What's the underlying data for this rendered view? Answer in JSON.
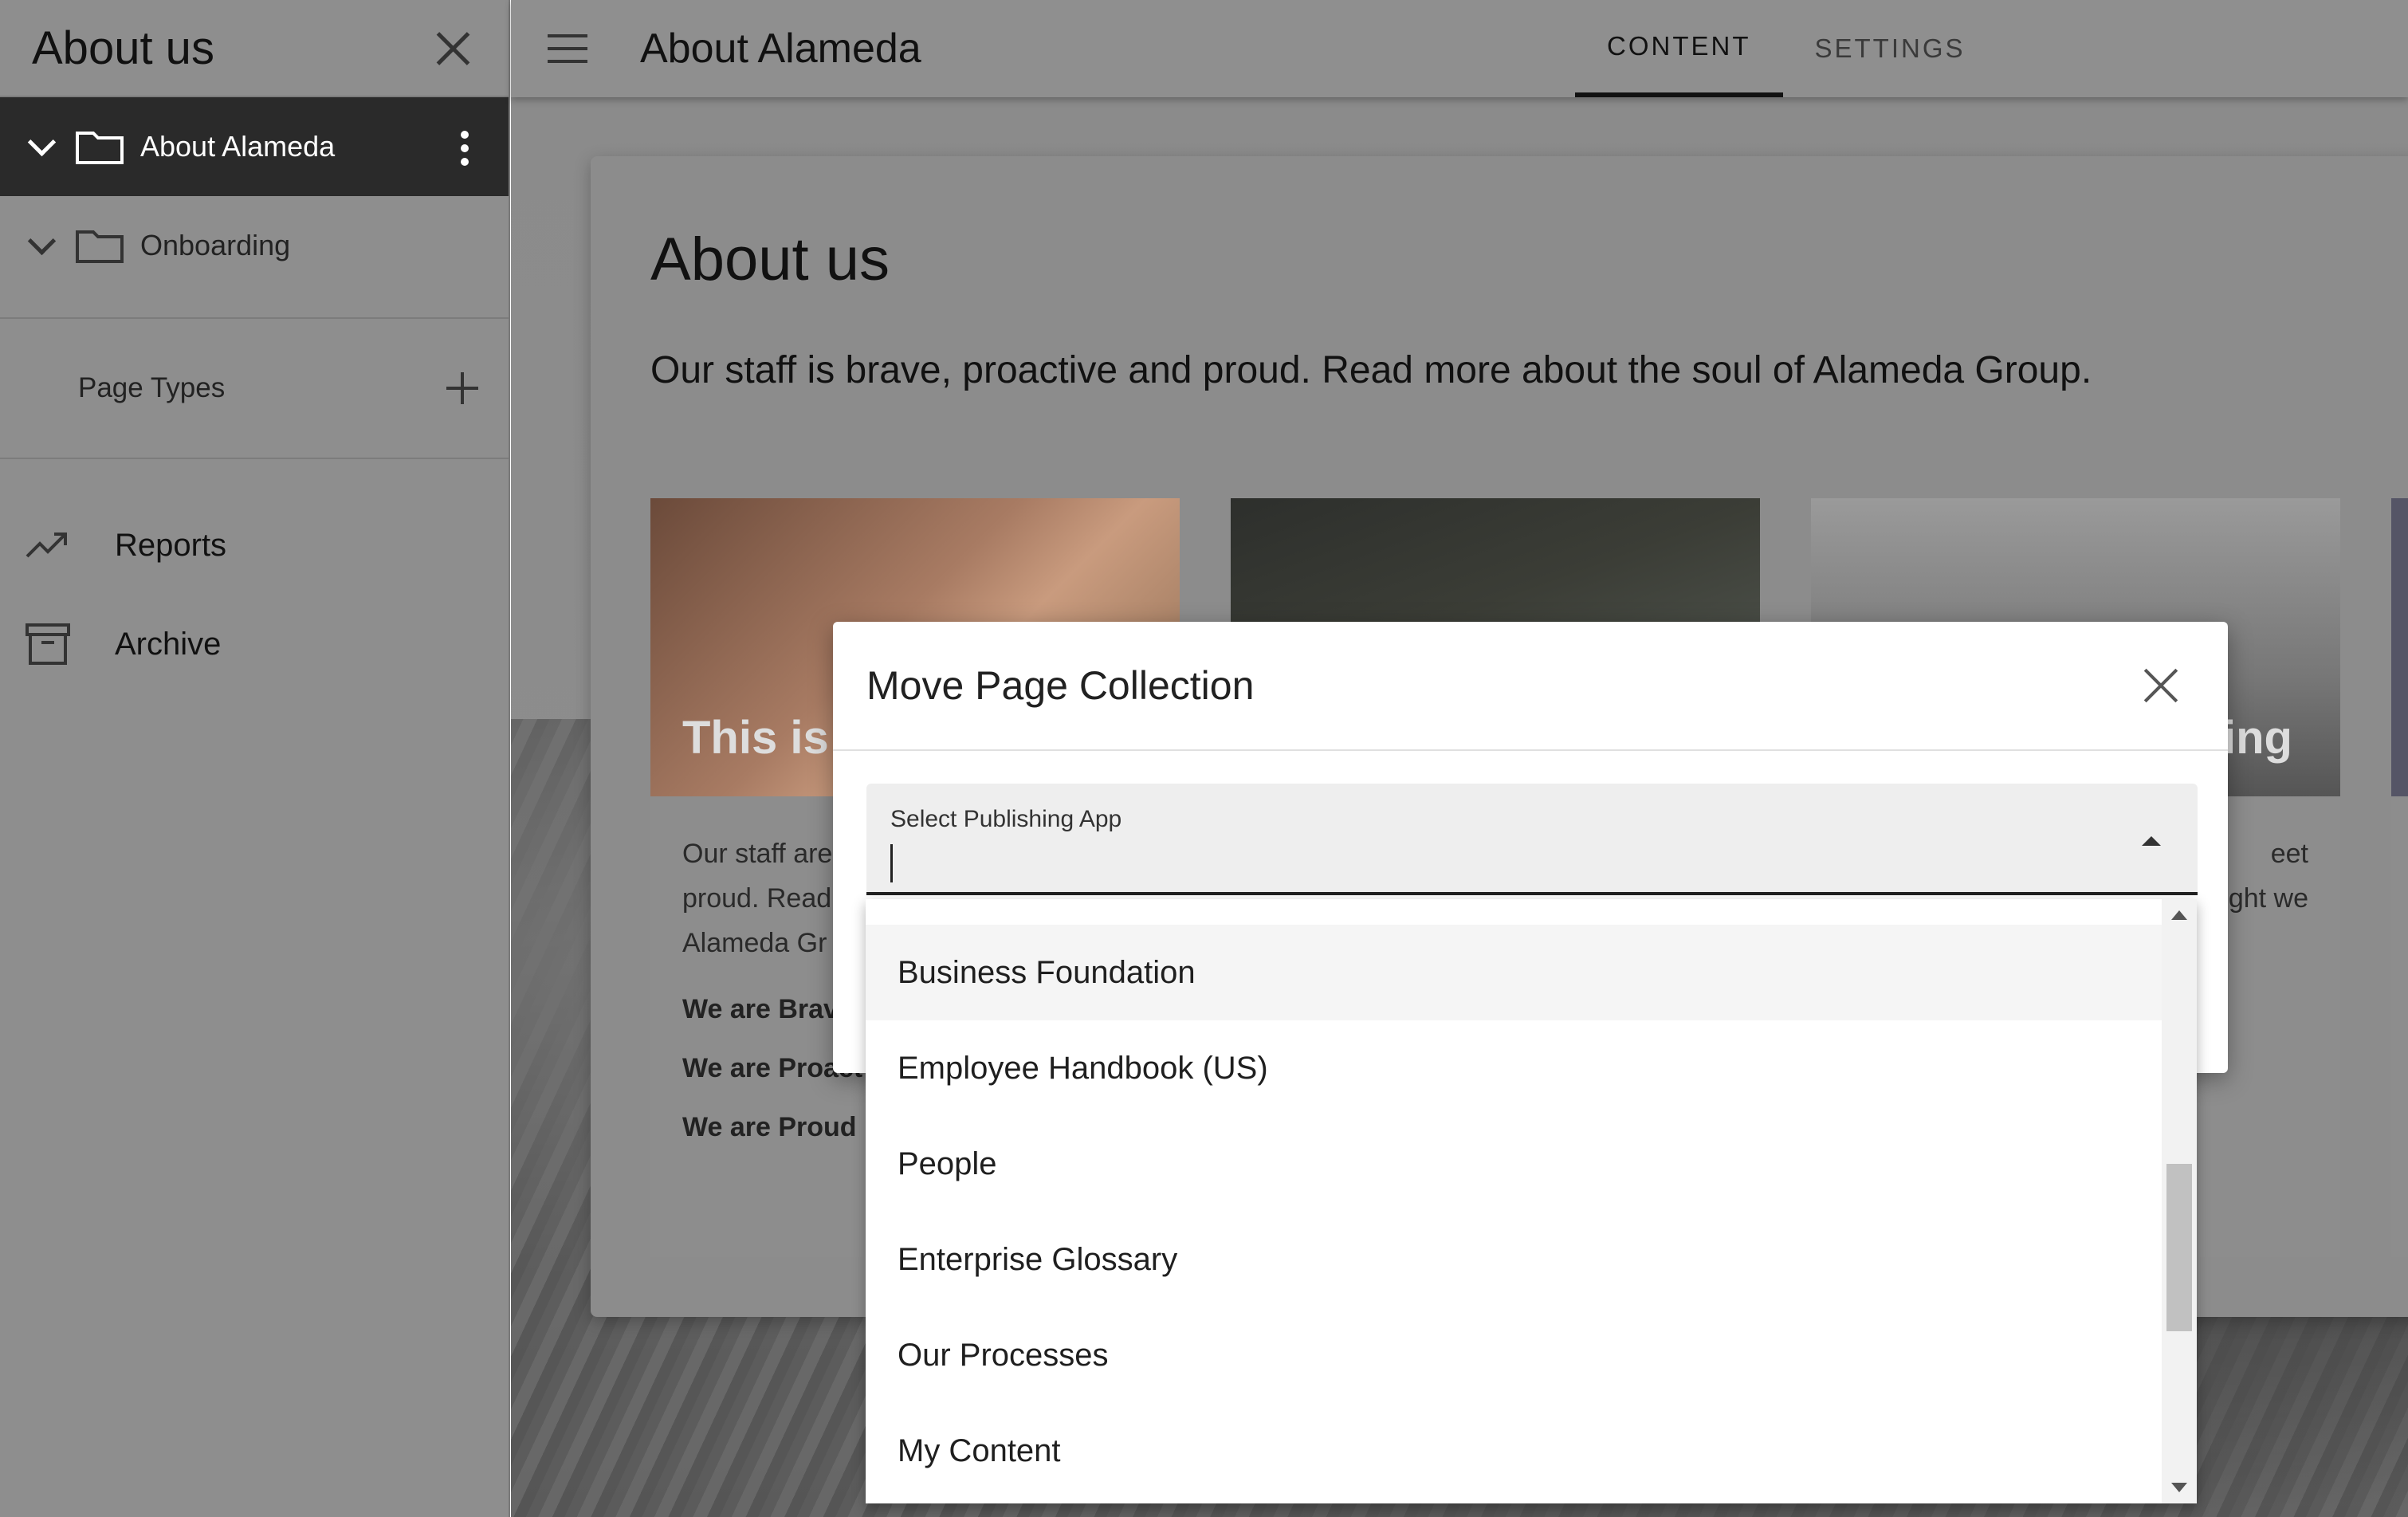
{
  "sidebar": {
    "title": "About us",
    "tree": [
      {
        "label": "About Alameda",
        "active": true
      },
      {
        "label": "Onboarding",
        "active": false
      }
    ],
    "page_types_label": "Page Types",
    "links": [
      {
        "label": "Reports",
        "icon": "trending-up-icon"
      },
      {
        "label": "Archive",
        "icon": "archive-icon"
      }
    ]
  },
  "topbar": {
    "title": "About Alameda",
    "tabs": [
      {
        "label": "CONTENT",
        "active": true
      },
      {
        "label": "SETTINGS",
        "active": false
      }
    ]
  },
  "page": {
    "heading": "About us",
    "subheading": "Our staff is brave, proactive and proud. Read more about the soul of Alameda Group.",
    "tile1": {
      "caption": "This is",
      "body_lines": [
        "Our staff are",
        "proud. Read",
        "Alameda Gr"
      ],
      "bold_lines": [
        "We are Brav",
        "We are Proact",
        "We are Proud"
      ]
    },
    "tile3": {
      "caption": "ing",
      "body_lines": [
        "eet",
        "ght we"
      ]
    }
  },
  "modal": {
    "title": "Move Page Collection",
    "select_label": "Select Publishing App",
    "select_value": "",
    "options": [
      "Business Foundation",
      "Employee Handbook (US)",
      "People",
      "Enterprise Glossary",
      "Our Processes",
      "My Content"
    ]
  },
  "colors": {
    "active_item_bg": "#2a2a2a",
    "overlay_gray": "#8e8e8e",
    "modal_bg": "#ffffff",
    "hover_bg": "#f5f5f5"
  }
}
